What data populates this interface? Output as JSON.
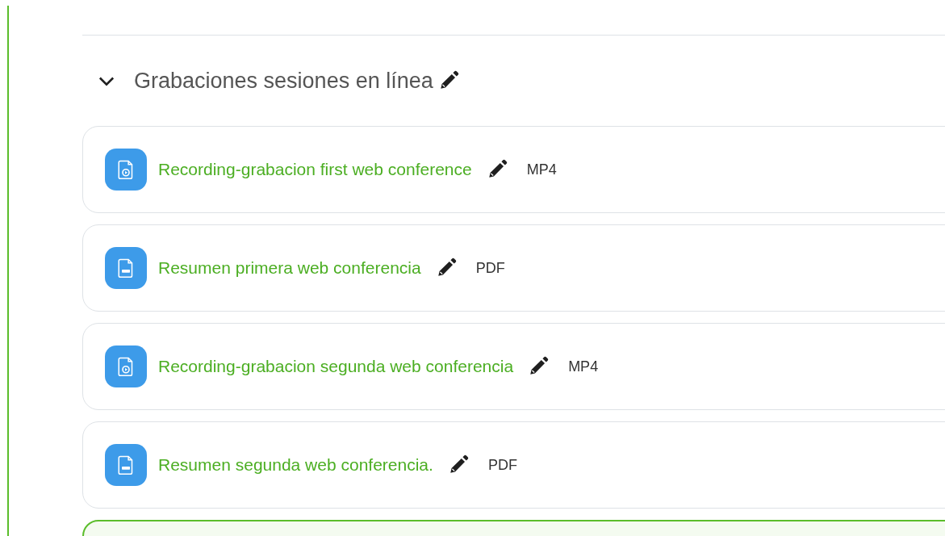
{
  "section": {
    "title": "Grabaciones sesiones en línea",
    "expanded": true,
    "activities": [
      {
        "kind": "video",
        "title": "Recording-grabacion first web conference",
        "type": "MP4"
      },
      {
        "kind": "pdf",
        "title": "Resumen primera web conferencia",
        "type": "PDF"
      },
      {
        "kind": "video",
        "title": "Recording-grabacion segunda web conferencia",
        "type": "MP4"
      },
      {
        "kind": "pdf",
        "title": "Resumen segunda web conferencia.",
        "type": "PDF"
      }
    ]
  }
}
